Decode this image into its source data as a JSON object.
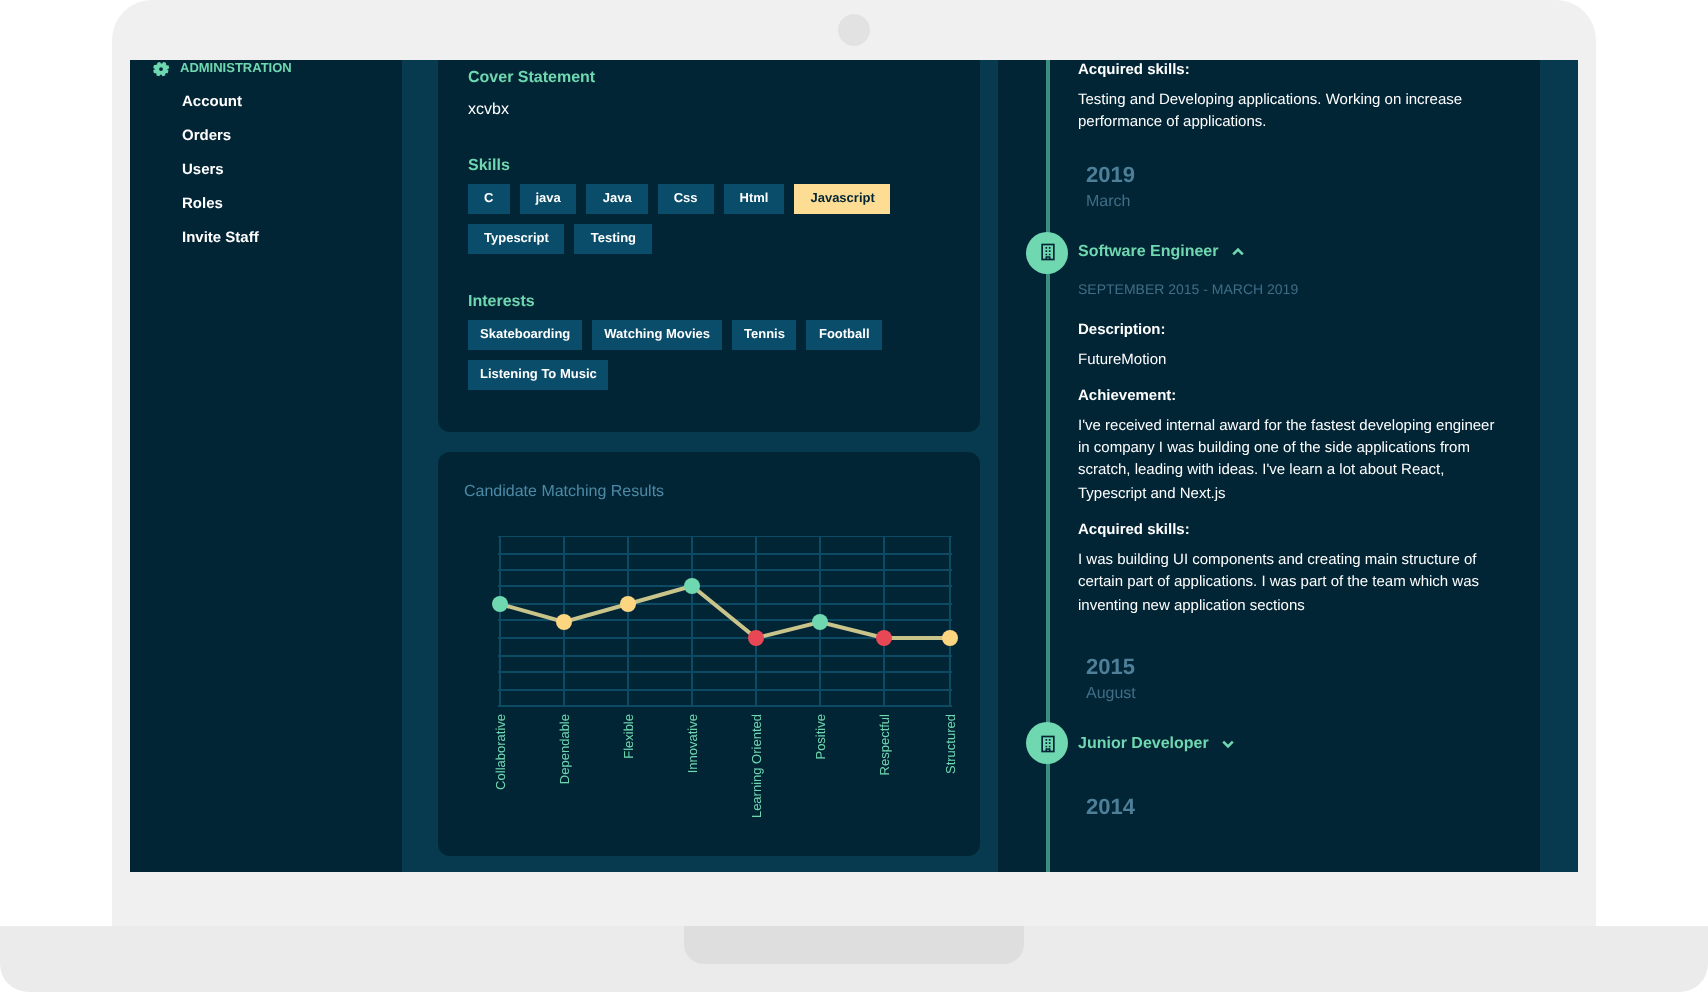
{
  "sidebar": {
    "section": {
      "title": "ADMINISTRATION"
    },
    "items": [
      {
        "label": "Account"
      },
      {
        "label": "Orders"
      },
      {
        "label": "Users"
      },
      {
        "label": "Roles"
      },
      {
        "label": "Invite Staff"
      }
    ]
  },
  "profile_card": {
    "cover_statement": {
      "heading": "Cover Statement",
      "value": "xcvbx"
    },
    "skills": {
      "heading": "Skills",
      "tags": [
        {
          "label": "C",
          "highlighted": false
        },
        {
          "label": "java",
          "highlighted": false
        },
        {
          "label": "Java",
          "highlighted": false
        },
        {
          "label": "Css",
          "highlighted": false
        },
        {
          "label": "Html",
          "highlighted": false
        },
        {
          "label": "Javascript",
          "highlighted": true
        },
        {
          "label": "Typescript",
          "highlighted": false
        },
        {
          "label": "Testing",
          "highlighted": false
        }
      ]
    },
    "interests": {
      "heading": "Interests",
      "tags": [
        {
          "label": "Skateboarding"
        },
        {
          "label": "Watching Movies"
        },
        {
          "label": "Tennis"
        },
        {
          "label": "Football"
        },
        {
          "label": "Listening To Music"
        }
      ]
    }
  },
  "chart": {
    "title": "Candidate Matching Results",
    "categories": [
      "Collaborative",
      "Dependable",
      "Flexible",
      "Innovative",
      "Learning Oriented",
      "Positive",
      "Respectful",
      "Structured"
    ]
  },
  "timeline": {
    "items": [
      {
        "kind": "section",
        "heading": "Acquired skills:",
        "text": "Testing and Developing applications. Working on increase performance of applications."
      },
      {
        "kind": "date",
        "year": "2019",
        "month": "March"
      },
      {
        "kind": "job",
        "title": "Software Engineer",
        "expanded": true,
        "dates": "SEPTEMBER 2015 - MARCH 2019",
        "sections": [
          {
            "heading": "Description:",
            "text": "FutureMotion"
          },
          {
            "heading": "Achievement:",
            "text": "I've received internal award for the fastest developing engineer in company I was building one of the side applications from scratch, leading with ideas. I've learn a lot about React, Typescript and Next.js"
          },
          {
            "heading": "Acquired skills:",
            "text": "I was building UI components and creating main structure of certain part of applications. I was part of the team which was inventing new application sections"
          }
        ]
      },
      {
        "kind": "date",
        "year": "2015",
        "month": "August"
      },
      {
        "kind": "job",
        "title": "Junior Developer",
        "expanded": false
      },
      {
        "kind": "date",
        "year": "2014"
      }
    ]
  }
}
